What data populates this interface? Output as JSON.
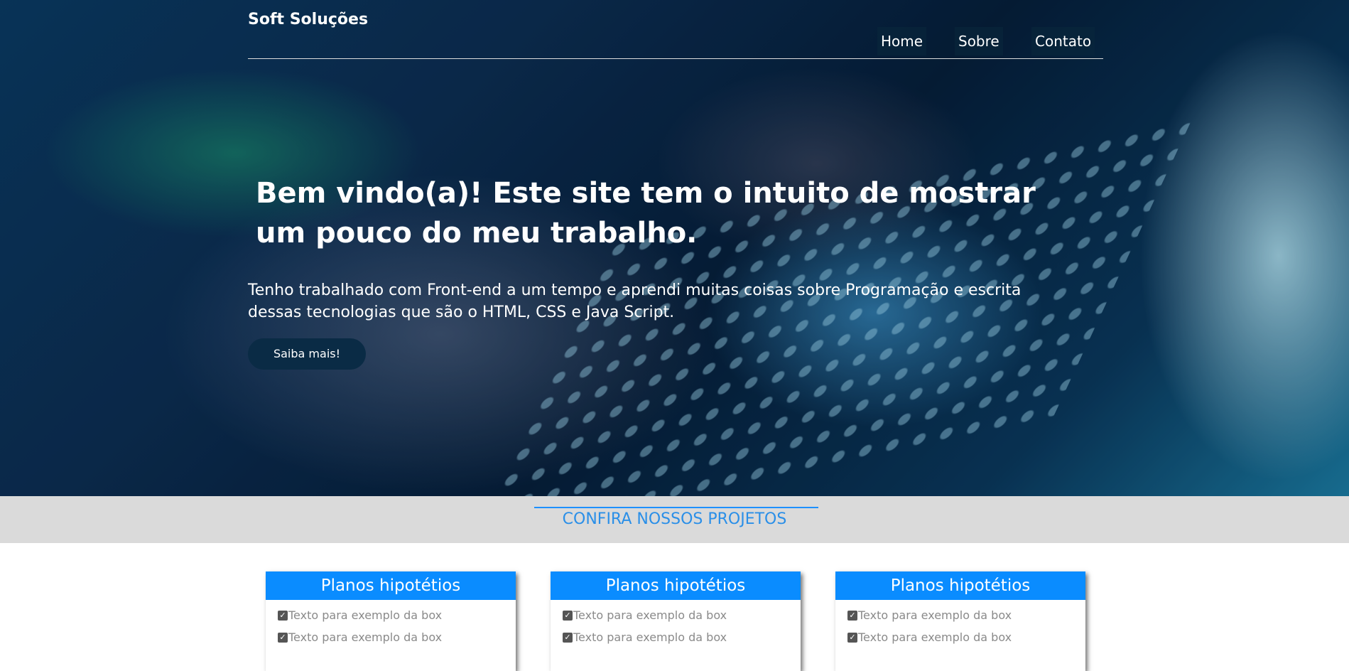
{
  "header": {
    "brand": "Soft Soluções",
    "nav": [
      {
        "label": "Home"
      },
      {
        "label": "Sobre"
      },
      {
        "label": "Contato"
      }
    ]
  },
  "hero": {
    "title": "Bem vindo(a)! Este site tem o intuito de mostrar um pouco do meu trabalho.",
    "text": "Tenho trabalhado com Front-end a um tempo e aprendi muitas coisas sobre Programação e escrita dessas tecnologias que são o HTML, CSS e Java Script.",
    "cta_label": "Saiba mais!"
  },
  "projects": {
    "section_title": "CONFIRA NOSSOS PROJETOS",
    "cards": [
      {
        "title": "Planos hipotétios",
        "items": [
          "Texto para exemplo da box",
          "Texto para exemplo da box"
        ]
      },
      {
        "title": "Planos hipotétios",
        "items": [
          "Texto para exemplo da box",
          "Texto para exemplo da box"
        ]
      },
      {
        "title": "Planos hipotétios",
        "items": [
          "Texto para exemplo da box",
          "Texto para exemplo da box"
        ]
      }
    ]
  },
  "icons": {
    "list_item": "checkbox-checked-icon"
  },
  "colors": {
    "accent": "#0a8cff",
    "section_title": "#2a8fe8",
    "cta_bg": "#0a2b45",
    "band_bg": "#dadada"
  }
}
